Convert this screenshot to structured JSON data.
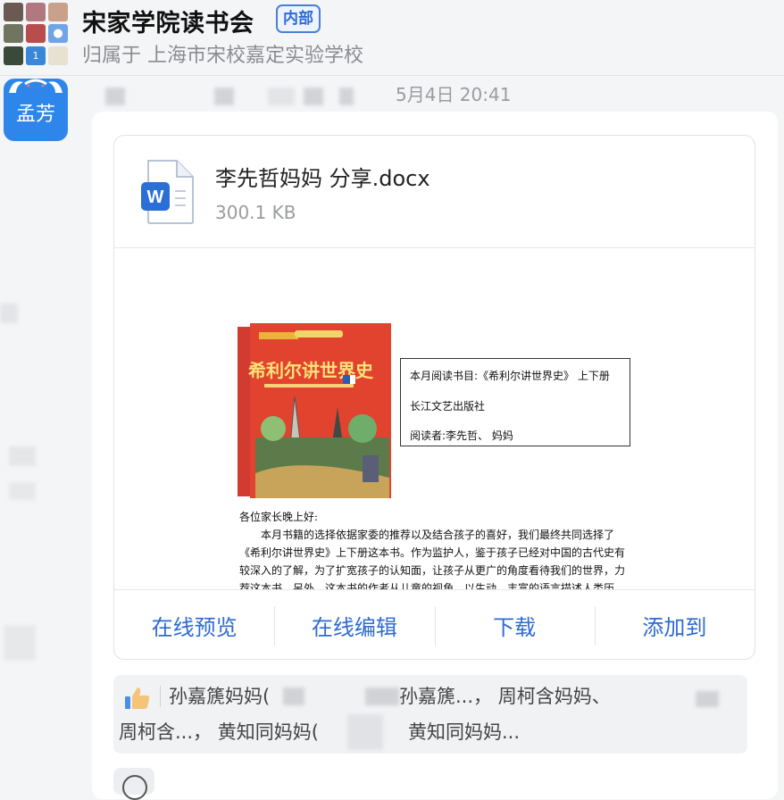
{
  "header": {
    "group_name": "宋家学院读书会",
    "badge": "内部",
    "belongs_to": "归属于 上海市宋校嘉定实验学校",
    "avatar_badge_number": "1"
  },
  "message": {
    "sender_name": "孟芳",
    "timestamp": "5月4日 20:41",
    "file": {
      "name": "李先哲妈妈 分享.docx",
      "size": "300.1 KB",
      "icon": "word-doc-icon",
      "icon_letter": "W"
    },
    "preview": {
      "book_title": "希利尔讲世界史",
      "info_lines": [
        "本月阅读书目:《希利尔讲世界史》 上下册",
        "长江文艺出版社",
        "阅读者:李先哲、 妈妈"
      ],
      "greeting": "各位家长晚上好:",
      "paragraph": "本月书籍的选择依据家委的推荐以及结合孩子的喜好，我们最终共同选择了《希利尔讲世界史》上下册这本书。作为监护人，鉴于孩子已经对中国的古代史有较深入的了解，为了扩宽孩子的认知面，让孩子从更广的角度看待我们的世界，力荐这本书。另外，这本书的作者从儿童的视角，以生动、丰富的语言描述人类历史，孩子和大人在阅读中有了共同语"
    },
    "actions": [
      "在线预览",
      "在线编辑",
      "下载",
      "添加到"
    ]
  },
  "likes": {
    "icon": "thumbs-up-icon",
    "line1a": "孙嘉篪妈妈(",
    "line1b": "孙嘉篪...， 周柯含妈妈、",
    "line2a": "周柯含...， 黄知同妈妈(",
    "line2b": "黄知同妈妈..."
  },
  "colors": {
    "accent": "#2f6bd1",
    "avatar_blue": "#2f86ea",
    "background": "#f4f5f7"
  }
}
